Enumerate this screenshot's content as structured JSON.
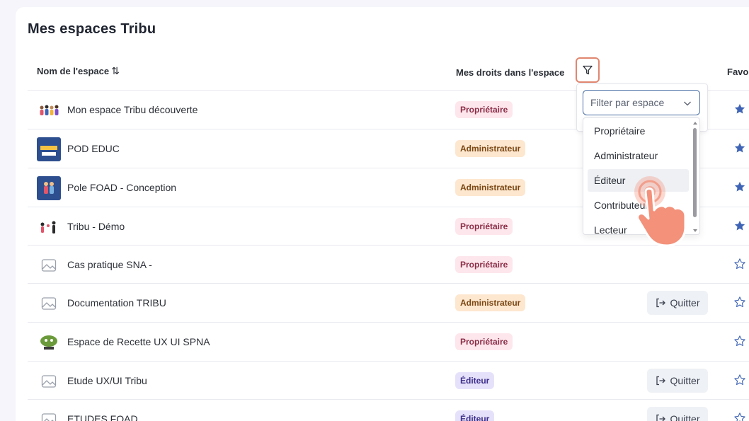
{
  "page_title": "Mes espaces Tribu",
  "columns": {
    "name": "Nom de l'espace",
    "rights": "Mes droits dans l'espace",
    "favorites": "Favo"
  },
  "filter": {
    "placeholder": "Filter par espace",
    "options": [
      "Propriétaire",
      "Administrateur",
      "Éditeur",
      "Contributeur",
      "Lecteur"
    ],
    "hovered": "Éditeur"
  },
  "quit_label": "Quitter",
  "rows": [
    {
      "name": "Mon espace Tribu découverte",
      "role": "Propriétaire",
      "favorite": true
    },
    {
      "name": "POD EDUC",
      "role": "Administrateur",
      "favorite": true
    },
    {
      "name": "Pole FOAD - Conception",
      "role": "Administrateur",
      "favorite": true
    },
    {
      "name": "Tribu - Démo",
      "role": "Propriétaire",
      "favorite": true
    },
    {
      "name": "Cas pratique SNA -",
      "role": "Propriétaire",
      "favorite": false
    },
    {
      "name": "Documentation TRIBU",
      "role": "Administrateur",
      "favorite": false,
      "quit": true
    },
    {
      "name": "Espace de Recette UX UI SPNA",
      "role": "Propriétaire",
      "favorite": false
    },
    {
      "name": "Etude UX/UI Tribu",
      "role": "Éditeur",
      "favorite": false,
      "quit": true
    },
    {
      "name": "ETUDES FOAD",
      "role": "Éditeur",
      "favorite": false,
      "quit": true
    }
  ],
  "colors": {
    "star": "#3f64b6",
    "filter_highlight": "#e0866f",
    "hand": "#f3917a"
  }
}
